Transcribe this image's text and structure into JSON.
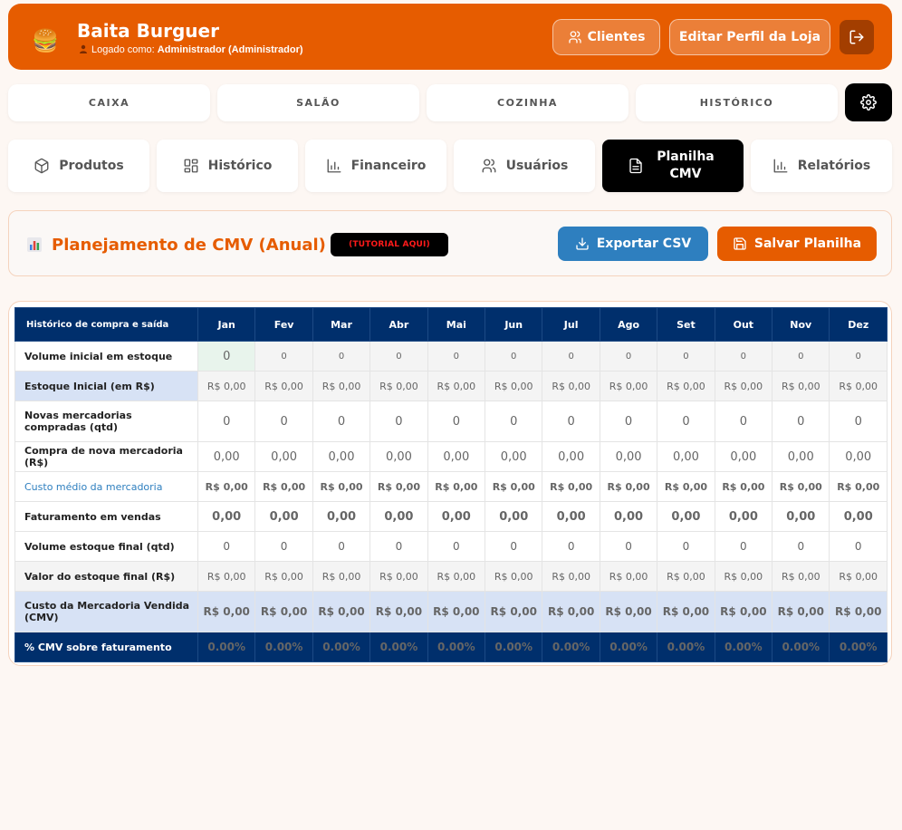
{
  "header": {
    "brand": "Baita Burguer",
    "logged_prefix": "Logado como:",
    "logged_user": "Administrador (Administrador)",
    "clientes_label": "Clientes",
    "perfil_label": "Editar Perfil da Loja",
    "logo_icon": "burger-icon",
    "accent": "#e65c00"
  },
  "nav": {
    "tabs": [
      "CAIXA",
      "SALÃO",
      "COZINHA",
      "HISTÓRICO"
    ]
  },
  "subtabs": {
    "produtos": "Produtos",
    "historico": "Histórico",
    "financeiro": "Financeiro",
    "usuarios": "Usuários",
    "planilha_line1": "Planilha",
    "planilha_line2": "CMV",
    "relatorios": "Relatórios"
  },
  "panel": {
    "title": "Planejamento de CMV (Anual)",
    "tutorial": "(TUTORIAL AQUI)",
    "export_label": "Exportar CSV",
    "save_label": "Salvar Planilha"
  },
  "table": {
    "header_label": "Histórico de compra e saída",
    "months": [
      "Jan",
      "Fev",
      "Mar",
      "Abr",
      "Mai",
      "Jun",
      "Jul",
      "Ago",
      "Set",
      "Out",
      "Nov",
      "Dez"
    ],
    "rows": [
      {
        "label": "Volume inicial em estoque",
        "values": [
          "0",
          "0",
          "0",
          "0",
          "0",
          "0",
          "0",
          "0",
          "0",
          "0",
          "0",
          "0"
        ]
      },
      {
        "label": "Estoque Inicial (em R$)",
        "values": [
          "R$ 0,00",
          "R$ 0,00",
          "R$ 0,00",
          "R$ 0,00",
          "R$ 0,00",
          "R$ 0,00",
          "R$ 0,00",
          "R$ 0,00",
          "R$ 0,00",
          "R$ 0,00",
          "R$ 0,00",
          "R$ 0,00"
        ]
      },
      {
        "label": "Novas mercadorias compradas (qtd)",
        "values": [
          "0",
          "0",
          "0",
          "0",
          "0",
          "0",
          "0",
          "0",
          "0",
          "0",
          "0",
          "0"
        ]
      },
      {
        "label": "Compra de nova mercadoria (R$)",
        "values": [
          "0,00",
          "0,00",
          "0,00",
          "0,00",
          "0,00",
          "0,00",
          "0,00",
          "0,00",
          "0,00",
          "0,00",
          "0,00",
          "0,00"
        ]
      },
      {
        "label": "Custo médio da mercadoria",
        "values": [
          "R$ 0,00",
          "R$ 0,00",
          "R$ 0,00",
          "R$ 0,00",
          "R$ 0,00",
          "R$ 0,00",
          "R$ 0,00",
          "R$ 0,00",
          "R$ 0,00",
          "R$ 0,00",
          "R$ 0,00",
          "R$ 0,00"
        ]
      },
      {
        "label": "Faturamento em vendas",
        "values": [
          "0,00",
          "0,00",
          "0,00",
          "0,00",
          "0,00",
          "0,00",
          "0,00",
          "0,00",
          "0,00",
          "0,00",
          "0,00",
          "0,00"
        ]
      },
      {
        "label": "Volume estoque final (qtd)",
        "values": [
          "0",
          "0",
          "0",
          "0",
          "0",
          "0",
          "0",
          "0",
          "0",
          "0",
          "0",
          "0"
        ]
      },
      {
        "label": "Valor do estoque final (R$)",
        "values": [
          "R$ 0,00",
          "R$ 0,00",
          "R$ 0,00",
          "R$ 0,00",
          "R$ 0,00",
          "R$ 0,00",
          "R$ 0,00",
          "R$ 0,00",
          "R$ 0,00",
          "R$ 0,00",
          "R$ 0,00",
          "R$ 0,00"
        ]
      },
      {
        "label": "Custo da Mercadoria Vendida (CMV)",
        "values": [
          "R$ 0,00",
          "R$ 0,00",
          "R$ 0,00",
          "R$ 0,00",
          "R$ 0,00",
          "R$ 0,00",
          "R$ 0,00",
          "R$ 0,00",
          "R$ 0,00",
          "R$ 0,00",
          "R$ 0,00",
          "R$ 0,00"
        ]
      },
      {
        "label": "% CMV sobre faturamento",
        "values": [
          "0.00%",
          "0.00%",
          "0.00%",
          "0.00%",
          "0.00%",
          "0.00%",
          "0.00%",
          "0.00%",
          "0.00%",
          "0.00%",
          "0.00%",
          "0.00%"
        ]
      }
    ]
  }
}
